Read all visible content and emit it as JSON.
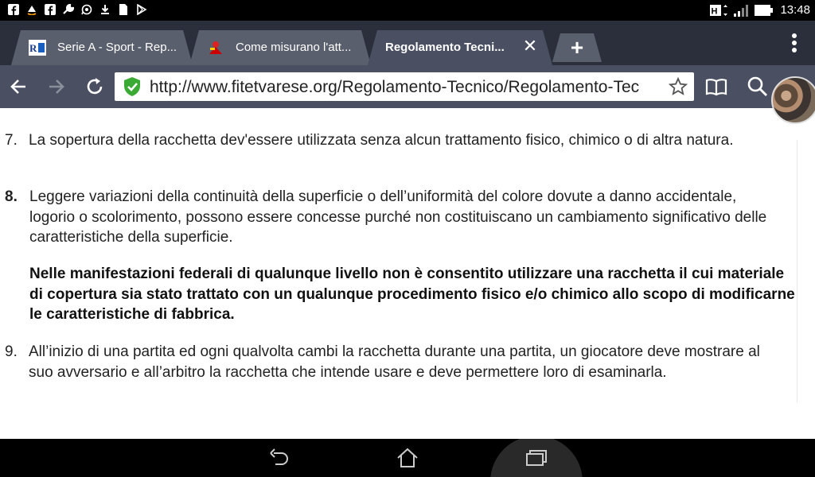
{
  "status_bar": {
    "time": "13:48",
    "left_icons": [
      "facebook-icon",
      "amazon-icon",
      "facebook-icon",
      "wrench-icon",
      "whatsapp-icon",
      "download-icon",
      "file-icon",
      "play-store-icon"
    ],
    "right_icons": [
      "hplus-signal-icon",
      "signal-bars-icon",
      "battery-icon"
    ]
  },
  "tabs": [
    {
      "label": "Serie A - Sport - Rep...",
      "icon": "repubblica-favicon",
      "active": false
    },
    {
      "label": "Come misurano l'att...",
      "icon": "red-figure-favicon",
      "active": false
    },
    {
      "label": "Regolamento Tecni...",
      "icon": "",
      "active": true
    }
  ],
  "toolbar": {
    "url": "http://www.fitetvarese.org/Regolamento-Tecnico/Regolamento-Tec",
    "icons": [
      "back-arrow-icon",
      "forward-arrow-icon",
      "reload-icon",
      "secure-shield-icon",
      "bookmark-star-icon",
      "reader-mode-icon",
      "search-icon"
    ]
  },
  "content": {
    "items": [
      {
        "number": "7.",
        "text": "La sopertura della racchetta dev'essere utilizzata senza alcun trattamento fisico, chimico o di altra natura."
      },
      {
        "number": "8.",
        "text": "Leggere variazioni della continuità della superficie o dell’uniformità del colore dovute a danno accidentale, logorio o scolorimento, possono essere concesse purché non costituiscano un cambiamento significativo delle caratteristiche della superficie."
      },
      {
        "number": "9.",
        "text": "All’inizio di una partita ed ogni qualvolta cambi la racchetta durante una partita, un giocatore deve mostrare al suo avversario e all’arbitro la racchetta che intende usare e deve permettere loro di esaminarla."
      }
    ],
    "note": "Nelle manifestazioni federali di qualunque livello non è consentito utilizzare una racchetta il cui materiale di copertura sia stato trattato con un qualunque procedimento fisico e/o chimico allo scopo di modificarne le caratteristiche di fabbrica."
  },
  "nav_bar": {
    "buttons": [
      "back-nav-icon",
      "home-icon",
      "recents-icon"
    ]
  },
  "colors": {
    "toolbar": "#4a5062",
    "tab_strip": "#2b2f3b",
    "secure_green": "#3aaa35"
  }
}
